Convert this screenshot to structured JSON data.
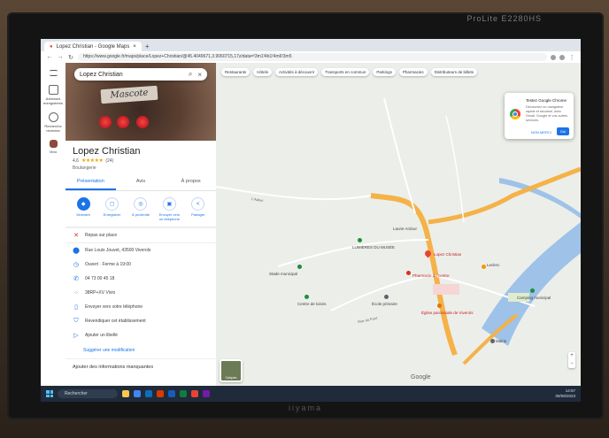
{
  "monitor": {
    "brand_top": "ProLite E2280HS",
    "brand_bottom": "iiyama"
  },
  "browser": {
    "tab_title": "Lopez Christian - Google Maps",
    "new_tab": "+",
    "url": "https://www.google.fr/maps/place/Lopez+Christian/@45.4049671,3.9060715,17z/data=!3m1!4b1!4m6!3m5"
  },
  "rail": [
    {
      "label": "",
      "icon": "menu-icon"
    },
    {
      "label": "Adresses enregistrées",
      "icon": "bookmark-icon"
    },
    {
      "label": "Recherche récentes",
      "icon": "history-icon"
    },
    {
      "label": "Vivio",
      "icon": "place-thumbnail"
    }
  ],
  "place": {
    "search_value": "Lopez Christian",
    "hero_card_text": "Mascote",
    "name": "Lopez Christian",
    "rating": "4,6",
    "stars": "★★★★★",
    "review_count": "(24)",
    "category": "Boulangerie",
    "tabs": [
      "Présentation",
      "Avis",
      "À propos"
    ],
    "actions": [
      {
        "label": "Itinéraire",
        "glyph": "◆"
      },
      {
        "label": "Enregistrer",
        "glyph": "◻"
      },
      {
        "label": "À proximité",
        "glyph": "◎"
      },
      {
        "label": "Envoyer vers un téléphone",
        "glyph": "▣"
      },
      {
        "label": "Partager",
        "glyph": "<"
      }
    ],
    "dine_in": "Repas sur place",
    "address": "Rue Louis Jouvet, 43500 Viverols",
    "hours": "Ouvert · Ferme à 19:00",
    "phone": "04 73 00 45 18",
    "plus_code": "38RP+XV Vivio",
    "send_phone": "Envoyer vers votre téléphone",
    "claim": "Revendiquer cet établissement",
    "add_label": "Ajouter un libellé",
    "suggest": "Suggérer une modification",
    "add_info": "Ajouter des informations manquantes"
  },
  "map": {
    "chips": [
      "Restaurants",
      "Hôtels",
      "Activités à découvrir",
      "Transports en commun",
      "Parkings",
      "Pharmacies",
      "Distributeurs de billets"
    ],
    "popup": {
      "title": "Testez Google Chrome",
      "body": "Découvrez un navigateur rapide et sécurisé, avec Gmail, Google et vos autres services.",
      "dismiss": "NON MERCI",
      "accept": "Oui"
    },
    "labels": {
      "lopez": "Lopez Christian",
      "laurie": "Laurie Ardour",
      "lumieres": "LUMIÈRES DU MUSÉE",
      "leclerc": "Leclerc",
      "eglise": "Église paroissiale de Viverols",
      "pharmacie": "Pharmacie du centre",
      "centre": "Centre de loisirs",
      "stade": "Stade municipal",
      "ecole": "École primaire",
      "mairie": "Mairie",
      "camping": "Camping municipal",
      "adour": "L'Adour",
      "road": "Rue du Pont"
    },
    "google_label": "Google",
    "layers_label": "Calques"
  },
  "taskbar": {
    "search_label": "Rechercher",
    "time": "14:57",
    "date": "09/08/2023"
  }
}
